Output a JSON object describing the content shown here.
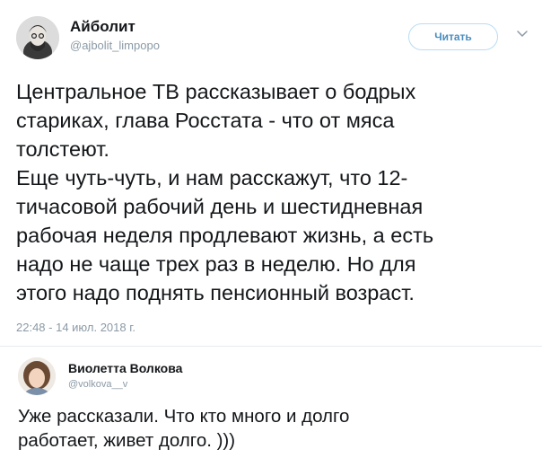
{
  "tweet": {
    "author_name": "Айболит",
    "author_handle": "@ajbolit_limpopo",
    "follow_label": "Читать",
    "text_lines": [
      "Центральное ТВ рассказывает о бодрых",
      "стариках, глава Росстата - что от мяса",
      "толстеют.",
      "Еще чуть-чуть, и нам расскажут, что 12-",
      "тичасовой рабочий день и шестидневная",
      "рабочая неделя продлевают жизнь, а есть",
      "надо не чаще трех раз в неделю. Но для",
      "этого надо поднять пенсионный возраст."
    ],
    "timestamp": "22:48 - 14 июл. 2018 г."
  },
  "reply": {
    "author_name": "Виолетта Волкова",
    "author_handle": "@volkova__v",
    "text_lines": [
      "Уже рассказали. Что кто много и долго",
      "работает, живет долго. )))"
    ]
  },
  "colors": {
    "text": "#14171a",
    "muted": "#8b9aa6",
    "follow_border": "#b9dcf4",
    "follow_text": "#4a8ec0",
    "divider": "#e6ecf0"
  },
  "icons": {
    "menu": "chevron-down-icon"
  }
}
